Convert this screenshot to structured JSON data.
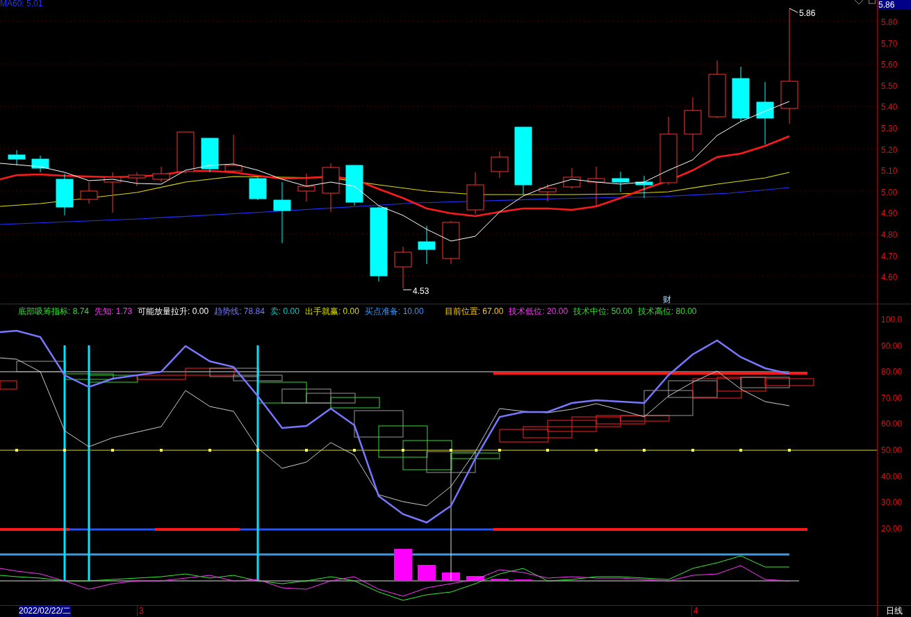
{
  "price_panel": {
    "ma_label": "MA60: 5.01",
    "price_flag": "5.86",
    "high_label": "5.86",
    "low_label": "4.53",
    "event_marker": "财",
    "axis_labels": [
      "5.80",
      "5.70",
      "5.60",
      "5.50",
      "5.40",
      "5.30",
      "5.20",
      "5.10",
      "5.00",
      "4.90",
      "4.80",
      "4.70",
      "4.60"
    ]
  },
  "indicator_panel": {
    "legend": [
      {
        "label": "底部吸筹指标:",
        "value": "8.74",
        "color": "#33dd33"
      },
      {
        "label": "先知:",
        "value": "1.73",
        "color": "#ff33ff"
      },
      {
        "label": "可能放量拉升:",
        "value": "0.00",
        "color": "#ffffff"
      },
      {
        "label": "趋势线:",
        "value": "78.84",
        "color": "#7777ff"
      },
      {
        "label": "卖:",
        "value": "0.00",
        "color": "#00cccc"
      },
      {
        "label": "出手就赢:",
        "value": "0.00",
        "color": "#dddd00"
      },
      {
        "label": "买点准备:",
        "value": "10.00",
        "color": "#3399ff"
      },
      {
        "label": "目前位置:",
        "value": "67.00",
        "color": "#ffcc00"
      },
      {
        "label": "技术低位:",
        "value": "20.00",
        "color": "#ff33ff"
      },
      {
        "label": "技术中位:",
        "value": "50.00",
        "color": "#33dd33"
      },
      {
        "label": "技术高位:",
        "value": "80.00",
        "color": "#33dd33"
      }
    ],
    "axis_labels": [
      "100.0",
      "90.00",
      "80.00",
      "70.00",
      "60.00",
      "50.00",
      "40.00",
      "30.00",
      "20.00"
    ]
  },
  "time_axis": {
    "date": "2022/02/22/二",
    "date_selected": true,
    "months": [
      "3",
      "4"
    ],
    "period": "日线"
  }
}
